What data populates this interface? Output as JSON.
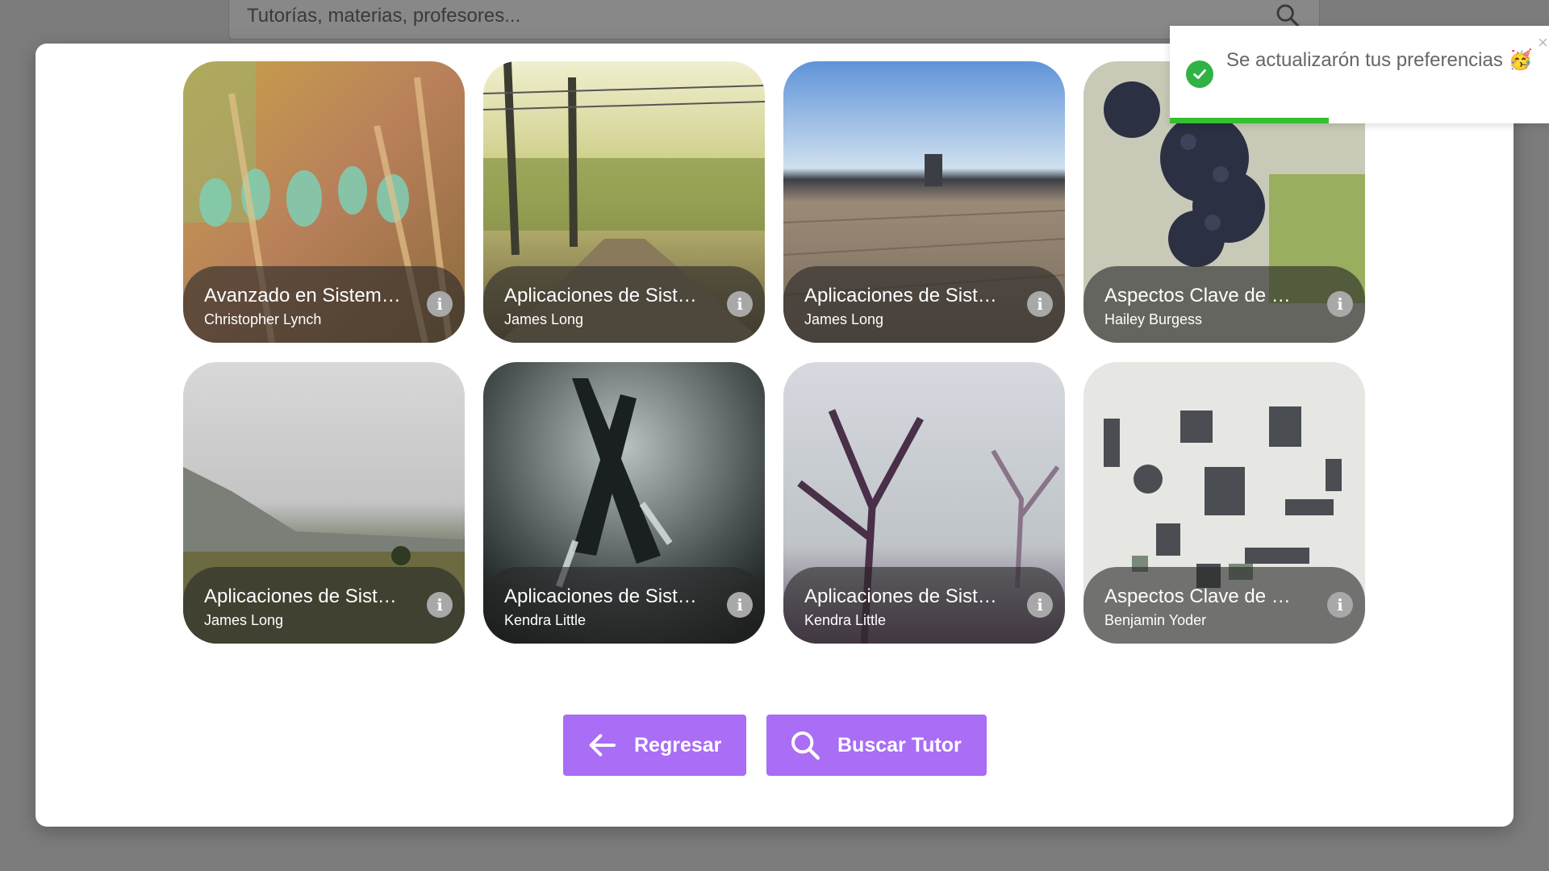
{
  "search": {
    "placeholder": "Tutorías, materias, profesores..."
  },
  "cards": [
    {
      "title": "Avanzado en Sistem…",
      "author": "Christopher Lynch",
      "scene": "bottles"
    },
    {
      "title": "Aplicaciones de Sist…",
      "author": "James Long",
      "scene": "railway"
    },
    {
      "title": "Aplicaciones de Sist…",
      "author": "James Long",
      "scene": "boardwalk"
    },
    {
      "title": "Aspectos Clave de …",
      "author": "Hailey Burgess",
      "scene": "grapes"
    },
    {
      "title": "Aplicaciones de Sist…",
      "author": "James Long",
      "scene": "valley"
    },
    {
      "title": "Aplicaciones de Sist…",
      "author": "Kendra Little",
      "scene": "forks"
    },
    {
      "title": "Aplicaciones de Sist…",
      "author": "Kendra Little",
      "scene": "trees"
    },
    {
      "title": "Aspectos Clave de …",
      "author": "Benjamin Yoder",
      "scene": "parts"
    }
  ],
  "info_glyph": "i",
  "buttons": {
    "back": "Regresar",
    "search": "Buscar Tutor"
  },
  "toast": {
    "message": "Se actualizarón tus preferencias 🥳",
    "close": "×",
    "progress": 0.42
  },
  "colors": {
    "accent": "#a96df6",
    "success": "#2fb344",
    "progress": "#35c02f"
  }
}
